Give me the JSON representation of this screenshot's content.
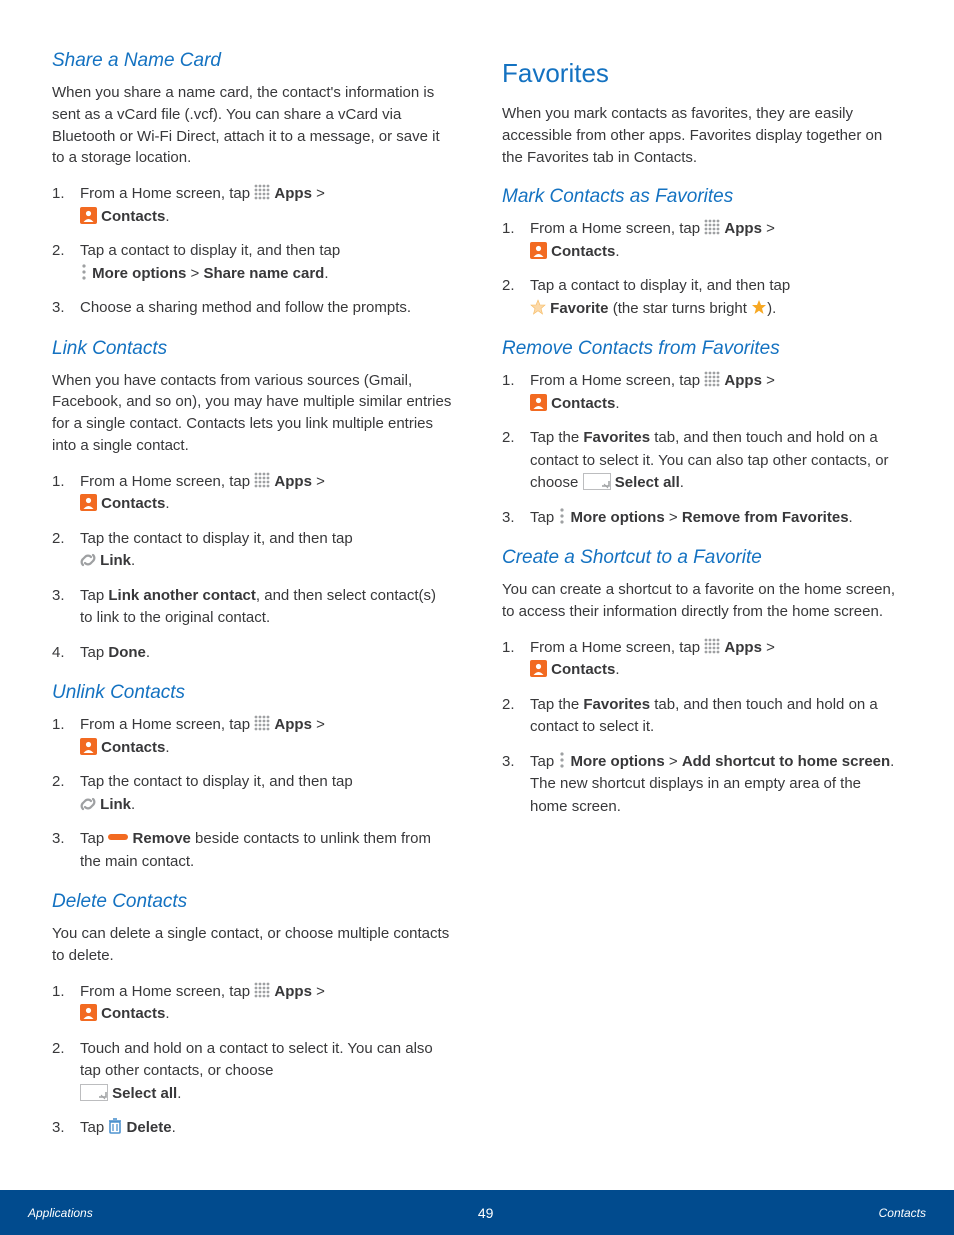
{
  "left": {
    "share": {
      "title": "Share a Name Card",
      "intro": "When you share a name card, the contact's information is sent as a vCard file (.vcf). You can share a vCard via Bluetooth or Wi-Fi Direct, attach it to a message, or save it to a storage location.",
      "s1a": "From a Home screen, tap ",
      "apps": "Apps",
      "gt": " > ",
      "contacts": "Contacts",
      "dot": ".",
      "s2a": "Tap a contact to display it, and then tap ",
      "moreopt": "More options",
      "s2b": "Share name card",
      "s3": "Choose a sharing method and follow the prompts."
    },
    "link": {
      "title": "Link Contacts",
      "intro": "When you have contacts from various sources (Gmail, Facebook, and so on), you may have multiple similar entries for a single contact. Contacts lets you link multiple entries into a single contact.",
      "s2a": "Tap the contact to display it, and then tap ",
      "linklbl": "Link",
      "s3a": "Tap ",
      "s3b": "Link another contact",
      "s3c": ", and then select contact(s) to link to the original contact.",
      "s4a": "Tap ",
      "s4b": "Done"
    },
    "unlink": {
      "title": "Unlink Contacts",
      "s3a": "Tap ",
      "s3b": "Remove",
      "s3c": " beside contacts to unlink them from the main contact."
    },
    "delete": {
      "title": "Delete Contacts",
      "intro": "You can delete a single contact, or choose multiple contacts to delete.",
      "s2a": "Touch and hold on a contact to select it. You can also tap other contacts, or choose ",
      "selectall": "Select all",
      "s3a": "Tap ",
      "s3b": "Delete"
    }
  },
  "right": {
    "fav": {
      "title": "Favorites",
      "intro": "When you mark contacts as favorites, they are easily accessible from other apps. Favorites display together on the Favorites tab in Contacts."
    },
    "mark": {
      "title": "Mark Contacts as Favorites",
      "s2a": "Tap a contact to display it, and then tap ",
      "favlbl": "Favorite",
      "s2b": " (the star turns bright ",
      "s2c": ")."
    },
    "remove": {
      "title": "Remove Contacts from Favorites",
      "s2a": "Tap the ",
      "s2b": "Favorites",
      "s2c": " tab, and then touch and hold on a contact to select it. You can also tap other contacts, or choose ",
      "s3a": "Tap ",
      "s3b": "More options",
      "s3c": "Remove from Favorites"
    },
    "shortcut": {
      "title": "Create a Shortcut to a Favorite",
      "intro": "You can create a shortcut to a favorite on the home screen, to access their information directly from the home screen.",
      "s2a": "Tap the ",
      "s2b": "Favorites",
      "s2c": " tab, and then touch and hold on a contact to select it.",
      "s3a": "Tap ",
      "s3b": "More options",
      "s3c": "Add shortcut to home screen",
      "s3d": ". The new shortcut displays in an empty area of the home screen."
    }
  },
  "footer": {
    "left": "Applications",
    "page": "49",
    "right": "Contacts"
  }
}
